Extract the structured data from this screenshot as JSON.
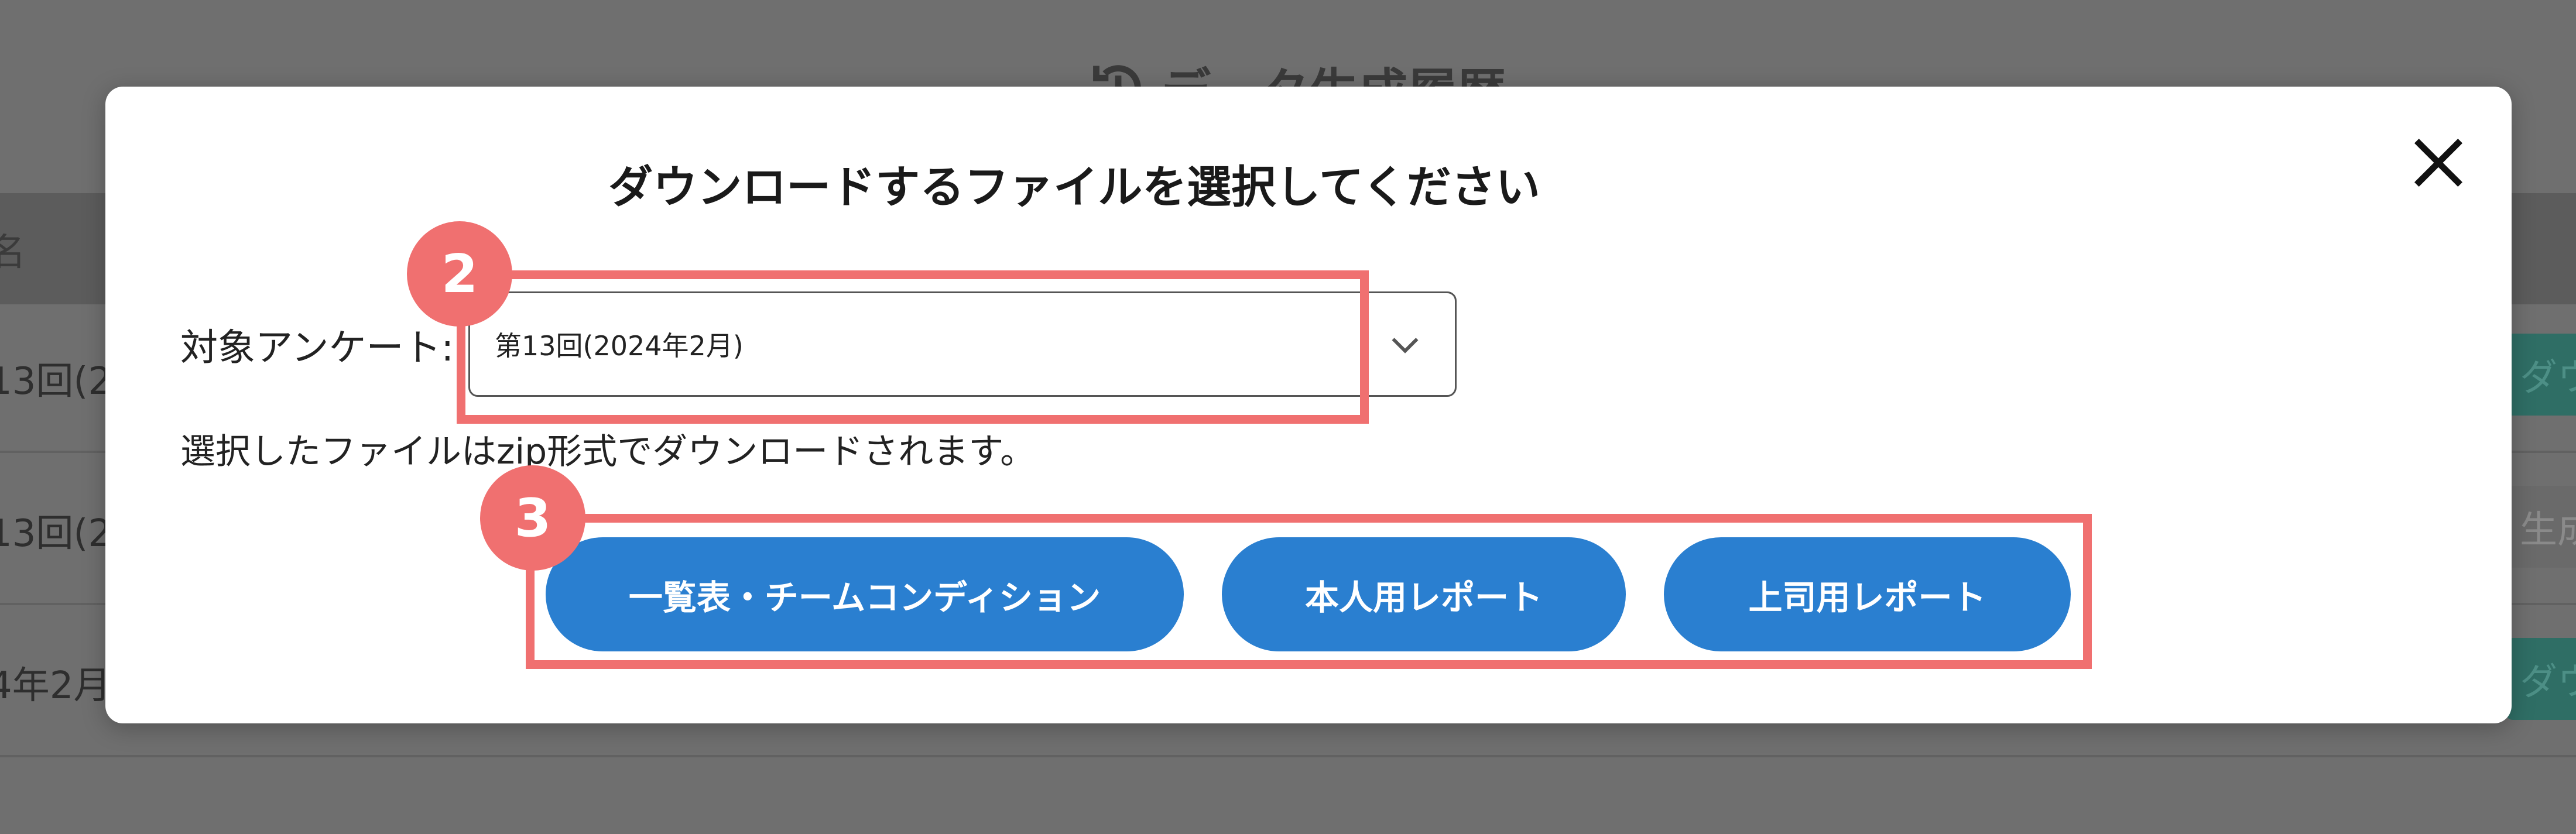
{
  "background": {
    "page_title": "データ生成履歴",
    "table_header_fragment": "名",
    "rows": [
      {
        "cell": "13回(2",
        "button": "ダウ",
        "button_state": "active"
      },
      {
        "cell": "13回(2",
        "button": "生成",
        "button_state": "disabled"
      },
      {
        "cell": "4年2月",
        "button": "ダウ",
        "button_state": "active"
      }
    ]
  },
  "modal": {
    "title": "ダウンロードするファイルを選択してください",
    "survey_label": "対象アンケート:",
    "survey_select": {
      "selected": "第13回(2024年2月)"
    },
    "note": "選択したファイルはzip形式でダウンロードされます。",
    "buttons": {
      "list_label": "一覧表・チームコンディション",
      "self_report_label": "本人用レポート",
      "boss_report_label": "上司用レポート"
    }
  },
  "annotations": {
    "badge_2": "2",
    "badge_3": "3"
  },
  "colors": {
    "primary_button": "#2a7fd0",
    "annotation": "#f07070",
    "overlay": "#6f6f6f",
    "download_button_bg": "#2f6e65"
  }
}
